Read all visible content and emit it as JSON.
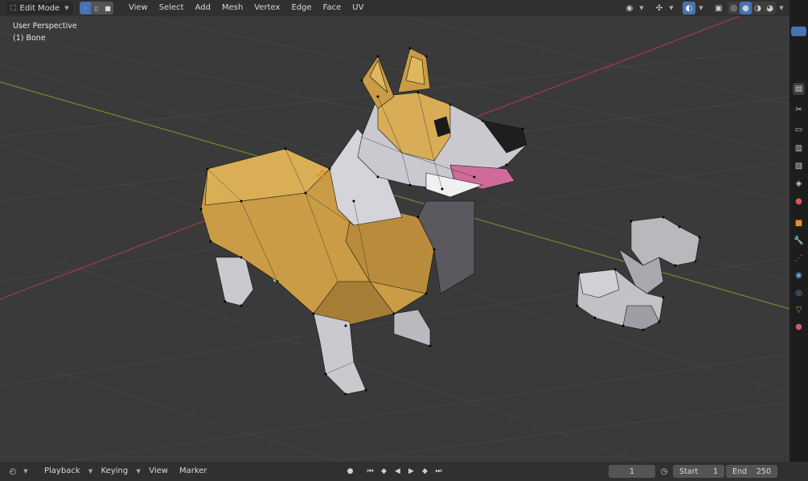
{
  "header": {
    "mode": "Edit Mode",
    "menus": [
      "View",
      "Select",
      "Add",
      "Mesh",
      "Vertex",
      "Edge",
      "Face",
      "UV"
    ]
  },
  "viewport": {
    "perspective_label": "User Perspective",
    "object_label": "(1) Bone"
  },
  "footer": {
    "menus": [
      "Playback",
      "Keying",
      "View",
      "Marker"
    ],
    "current_frame": "1",
    "start_label": "Start",
    "start_value": "1",
    "end_label": "End",
    "end_value": "250"
  },
  "colors": {
    "accent": "#4772b3",
    "viewport_bg": "#3a3a3a",
    "grid": "#454545",
    "x_axis": "#a33a4a",
    "y_axis": "#6e8f2a",
    "fur": "#c99c45",
    "white_fur": "#c9c9cf",
    "bone": "#b8b8bd"
  },
  "icons": {
    "editor_type": "mesh-editor-icon",
    "vertex_select": "vertex-select-icon",
    "edge_select": "edge-select-icon",
    "face_select": "face-select-icon",
    "visibility": "eye-icon",
    "gizmo": "gizmo-icon",
    "overlays": "overlay-icon",
    "xray": "xray-icon",
    "shading_wire": "wireframe-icon",
    "shading_solid": "solid-icon",
    "shading_material": "material-icon",
    "shading_rendered": "rendered-icon"
  }
}
